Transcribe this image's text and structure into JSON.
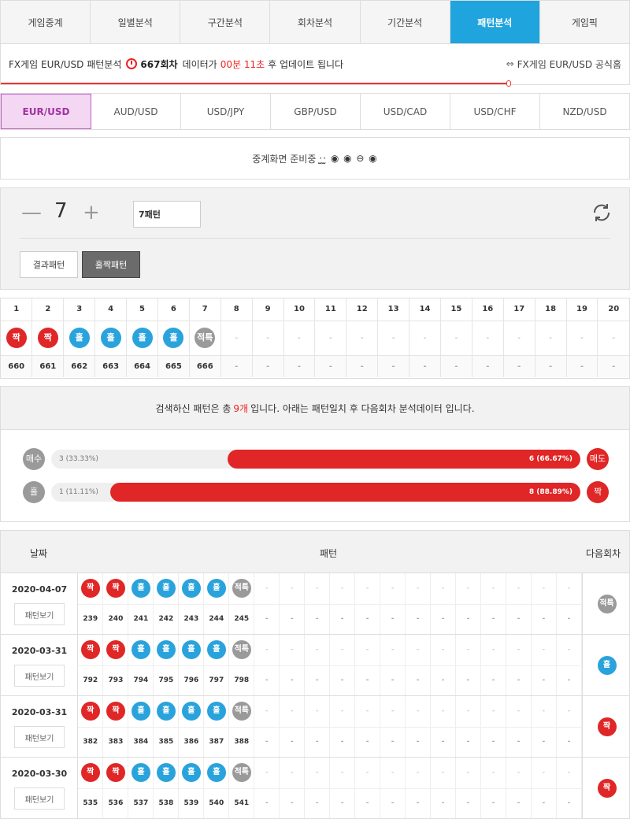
{
  "nav": {
    "tabs": [
      {
        "label": "게임중계",
        "active": false
      },
      {
        "label": "일별분석",
        "active": false
      },
      {
        "label": "구간분석",
        "active": false
      },
      {
        "label": "회차분석",
        "active": false
      },
      {
        "label": "기간분석",
        "active": false
      },
      {
        "label": "패턴분석",
        "active": true
      },
      {
        "label": "게임픽",
        "active": false
      }
    ]
  },
  "info": {
    "prefix": "FX게임 EUR/USD 패턴분석",
    "round": "667회차",
    "data_text": "데이터가",
    "countdown": "00분 11초",
    "suffix": "후 업데이트 됩니다",
    "official_link": "FX게임 EUR/USD 공식홈",
    "progress_fraction": 0.81
  },
  "currencies": [
    {
      "label": "EUR/USD",
      "active": true
    },
    {
      "label": "AUD/USD",
      "active": false
    },
    {
      "label": "USD/JPY",
      "active": false
    },
    {
      "label": "GBP/USD",
      "active": false
    },
    {
      "label": "USD/CAD",
      "active": false
    },
    {
      "label": "USD/CHF",
      "active": false
    },
    {
      "label": "NZD/USD",
      "active": false
    }
  ],
  "broadcast": {
    "text": "중계화면 준비중",
    "deco": "·̫·̫ ◉ ◉ ⊖ ◉"
  },
  "control": {
    "minus": "—",
    "value": "7",
    "plus": "+",
    "input_value": "7패턴",
    "result_btn": "결과패턴",
    "oddeven_btn": "홀짝패턴"
  },
  "grid": {
    "headers": [
      "1",
      "2",
      "3",
      "4",
      "5",
      "6",
      "7",
      "8",
      "9",
      "10",
      "11",
      "12",
      "13",
      "14",
      "15",
      "16",
      "17",
      "18",
      "19",
      "20"
    ],
    "balls": [
      {
        "label": "짝",
        "color": "red"
      },
      {
        "label": "짝",
        "color": "red"
      },
      {
        "label": "홀",
        "color": "blue"
      },
      {
        "label": "홀",
        "color": "blue"
      },
      {
        "label": "홀",
        "color": "blue"
      },
      {
        "label": "홀",
        "color": "blue"
      },
      {
        "label": "적특",
        "color": "gray"
      }
    ],
    "rounds": [
      "660",
      "661",
      "662",
      "663",
      "664",
      "665",
      "666"
    ],
    "dash": "-"
  },
  "summary": {
    "before": "검색하신 패턴은 총",
    "count": "9개",
    "after": "입니다. 아래는 패턴일치 후 다음회차 분석데이터 입니다."
  },
  "stats": [
    {
      "left_label": "매수",
      "left_text": "3 (33.33%)",
      "right_text": "6 (66.67%)",
      "right_label": "매도",
      "right_fraction": 0.6667
    },
    {
      "left_label": "홀",
      "left_text": "1 (11.11%)",
      "right_text": "8 (88.89%)",
      "right_label": "짝",
      "right_fraction": 0.8889
    }
  ],
  "history": {
    "header_date": "날짜",
    "header_pattern": "패턴",
    "header_next": "다음회차",
    "view_label": "패턴보기",
    "rows": [
      {
        "date": "2020-04-07",
        "rounds": [
          "239",
          "240",
          "241",
          "242",
          "243",
          "244",
          "245"
        ],
        "next": {
          "label": "적특",
          "color": "gray"
        }
      },
      {
        "date": "2020-03-31",
        "rounds": [
          "792",
          "793",
          "794",
          "795",
          "796",
          "797",
          "798"
        ],
        "next": {
          "label": "홀",
          "color": "blue"
        }
      },
      {
        "date": "2020-03-31",
        "rounds": [
          "382",
          "383",
          "384",
          "385",
          "386",
          "387",
          "388"
        ],
        "next": {
          "label": "짝",
          "color": "red"
        }
      },
      {
        "date": "2020-03-30",
        "rounds": [
          "535",
          "536",
          "537",
          "538",
          "539",
          "540",
          "541"
        ],
        "next": {
          "label": "짝",
          "color": "red"
        }
      }
    ]
  },
  "colors": {
    "accent": "#1fa4dd",
    "red": "#e02626",
    "blue": "#2aa3dc",
    "gray": "#9a9a9a"
  }
}
